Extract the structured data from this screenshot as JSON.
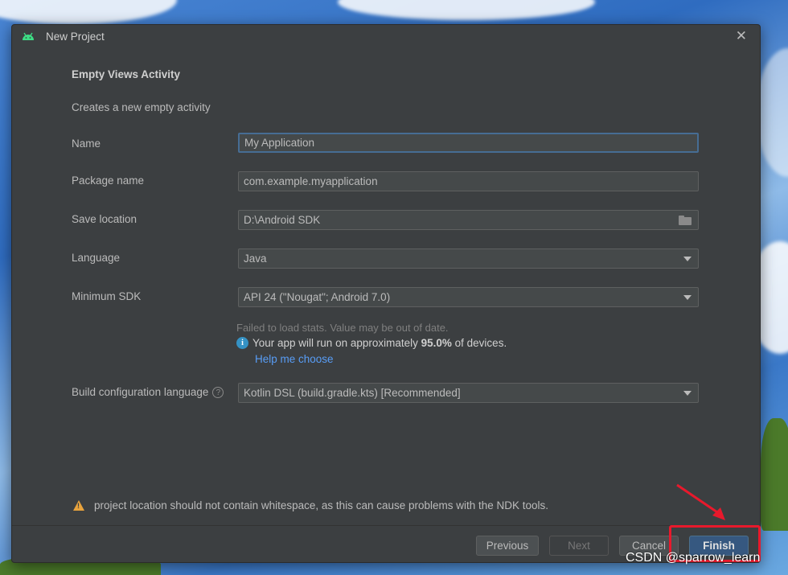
{
  "window": {
    "title": "New Project"
  },
  "template": {
    "heading": "Empty Views Activity",
    "subtitle": "Creates a new empty activity"
  },
  "form": {
    "name": {
      "label": "Name",
      "value": "My Application"
    },
    "package": {
      "label": "Package name",
      "value": "com.example.myapplication"
    },
    "save_location": {
      "label": "Save location",
      "value": "D:\\Android SDK"
    },
    "language": {
      "label": "Language",
      "value": "Java"
    },
    "min_sdk": {
      "label": "Minimum SDK",
      "value": "API 24 (\"Nougat\"; Android 7.0)"
    },
    "build_config": {
      "label": "Build configuration language",
      "value": "Kotlin DSL (build.gradle.kts) [Recommended]"
    }
  },
  "stats": {
    "warning": "Failed to load stats. Value may be out of date.",
    "info_prefix": "Your app will run on approximately ",
    "info_percent": "95.0%",
    "info_suffix": " of devices.",
    "help_link": "Help me choose"
  },
  "warning_message": "project location should not contain whitespace, as this can cause problems with the NDK tools.",
  "buttons": {
    "previous": "Previous",
    "next": "Next",
    "cancel": "Cancel",
    "finish": "Finish"
  },
  "watermark": "CSDN @sparrow_learn",
  "icons": {
    "window": "android-icon",
    "close": "close-icon",
    "folder": "folder-icon",
    "dropdown": "chevron-down-icon",
    "info": "info-icon",
    "help": "question-icon",
    "warning": "warning-icon"
  },
  "colors": {
    "dialog_bg": "#3c3f41",
    "android_green": "#3ddc84",
    "link": "#589df6",
    "primary_button": "#365880",
    "annotation_red": "#e8192c"
  }
}
